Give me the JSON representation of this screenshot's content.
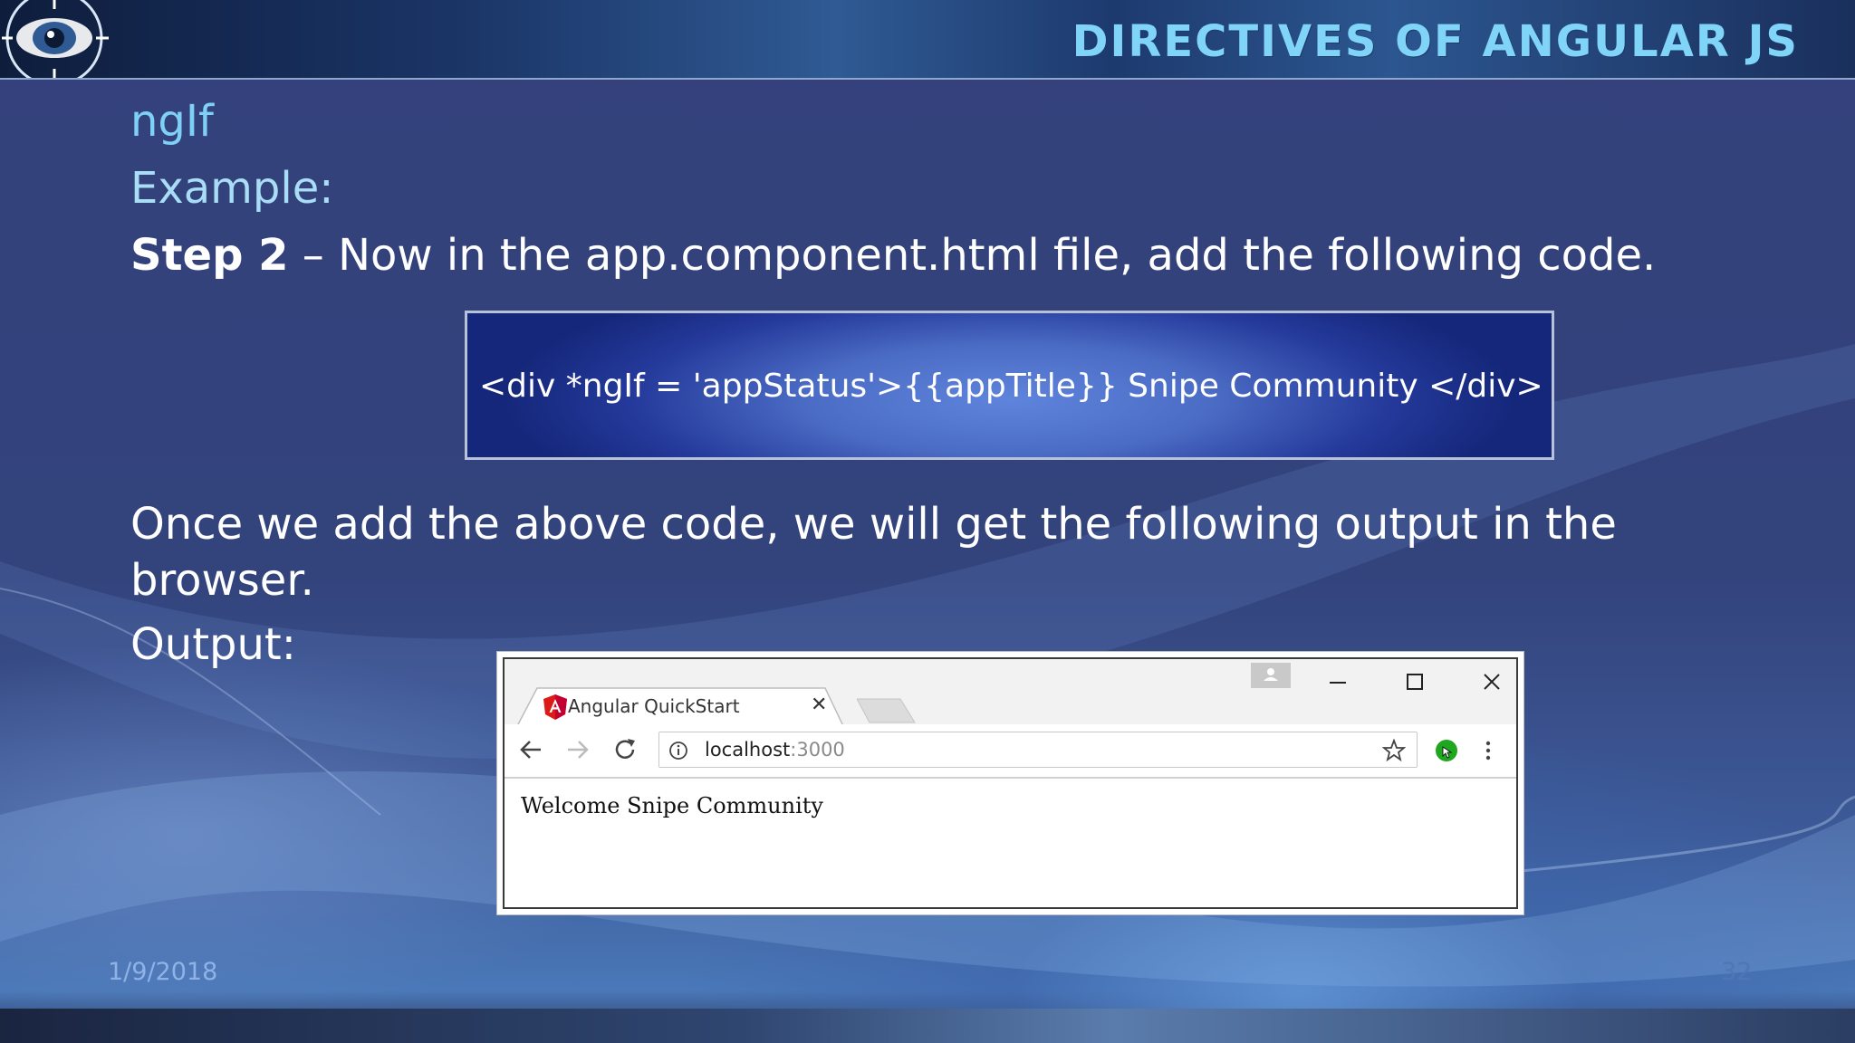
{
  "slide": {
    "title": "DIRECTIVES OF ANGULAR JS",
    "heading": "ngIf",
    "example_label": "Example:",
    "step_label": "Step 2",
    "step_text": " – Now in the app.component.html file, add the following code.",
    "code": "<div *ngIf = 'appStatus'>{{appTitle}} Snipe Community </div>",
    "paragraph": "Once we add the above code, we will get the following output in the browser.",
    "output_label": "Output:",
    "footer_date": "1/9/2018",
    "page_number": "32"
  },
  "browser": {
    "tab_title": "Angular QuickStart",
    "tab_close": "✕",
    "url_host": "localhost",
    "url_port": ":3000",
    "page_text": "Welcome Snipe Community"
  },
  "colors": {
    "title": "#7fd4f7",
    "heading": "#7fd0f7",
    "code_box": "#4b6cc5",
    "angular_red": "#dd1b16",
    "extension_green": "#1fa81f"
  }
}
